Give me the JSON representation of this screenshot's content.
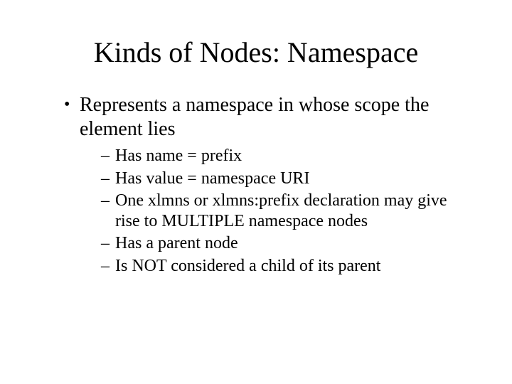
{
  "title": "Kinds of Nodes: Namespace",
  "bullets": [
    {
      "text": "Represents a namespace in whose  scope the element lies",
      "sub": [
        "Has name = prefix",
        "Has value  = namespace URI",
        "One xlmns or xlmns:prefix declaration may give rise to  MULTIPLE namespace nodes",
        "Has a parent node",
        "Is NOT  considered a child of its parent"
      ]
    }
  ]
}
